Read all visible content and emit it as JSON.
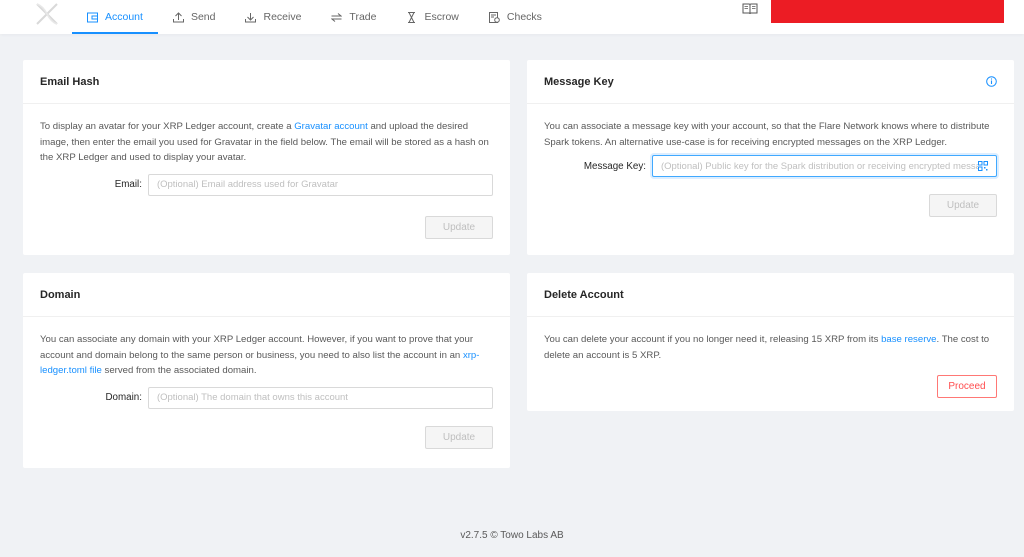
{
  "nav": {
    "items": [
      {
        "label": "Account",
        "icon": "wallet-icon",
        "active": true
      },
      {
        "label": "Send",
        "icon": "upload-icon"
      },
      {
        "label": "Receive",
        "icon": "download-icon"
      },
      {
        "label": "Trade",
        "icon": "swap-icon"
      },
      {
        "label": "Escrow",
        "icon": "hourglass-icon"
      },
      {
        "label": "Checks",
        "icon": "check-document-icon"
      }
    ],
    "accent_color": "#1890ff",
    "banner_color": "#ec1c24"
  },
  "email_hash": {
    "title": "Email Hash",
    "text_before": "To display an avatar for your XRP Ledger account, create a ",
    "link": "Gravatar account",
    "text_after": " and upload the desired image, then enter the email you used for Gravatar in the field below. The email will be stored as a hash on the XRP Ledger and used to display your avatar.",
    "label": "Email",
    "placeholder": "(Optional) Email address used for Gravatar",
    "button": "Update"
  },
  "message_key": {
    "title": "Message Key",
    "text": "You can associate a message key with your account, so that the Flare Network knows where to distribute Spark tokens. An alternative use-case is for receiving encrypted messages on the XRP Ledger.",
    "label": "Message Key",
    "placeholder": "(Optional) Public key for the Spark distribution or receiving encrypted messages",
    "button": "Update"
  },
  "domain": {
    "title": "Domain",
    "text_before": "You can associate any domain with your XRP Ledger account. However, if you want to prove that your account and domain belong to the same person or business, you need to also list the account in an ",
    "link": "xrp-ledger.toml file",
    "text_after": " served from the associated domain.",
    "label": "Domain",
    "placeholder": "(Optional) The domain that owns this account",
    "button": "Update"
  },
  "delete_account": {
    "title": "Delete Account",
    "text_before": "You can delete your account if you no longer need it, releasing 15 XRP from its ",
    "link": "base reserve",
    "text_after": ". The cost to delete an account is 5 XRP.",
    "button": "Proceed"
  },
  "footer": {
    "text": "v2.7.5 © Towo Labs AB"
  }
}
